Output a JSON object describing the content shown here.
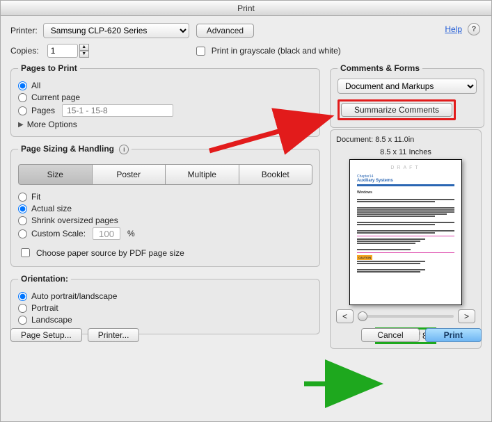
{
  "title": "Print",
  "help_label": "Help",
  "printer": {
    "label": "Printer:",
    "selected": "Samsung CLP-620 Series",
    "advanced": "Advanced"
  },
  "copies": {
    "label": "Copies:",
    "value": "1",
    "grayscale": "Print in grayscale (black and white)"
  },
  "pages": {
    "legend": "Pages to Print",
    "all": "All",
    "current": "Current page",
    "pages": "Pages",
    "range_placeholder": "15-1 - 15-8",
    "more_options": "More Options"
  },
  "sizing": {
    "legend": "Page Sizing & Handling",
    "tabs": {
      "size": "Size",
      "poster": "Poster",
      "multiple": "Multiple",
      "booklet": "Booklet"
    },
    "fit": "Fit",
    "actual": "Actual size",
    "shrink": "Shrink oversized pages",
    "custom": "Custom Scale:",
    "custom_value": "100",
    "percent": "%",
    "choose_source": "Choose paper source by PDF page size"
  },
  "orientation": {
    "legend": "Orientation:",
    "auto": "Auto portrait/landscape",
    "portrait": "Portrait",
    "landscape": "Landscape"
  },
  "comments_forms": {
    "legend": "Comments & Forms",
    "selected": "Document and Markups",
    "summarize": "Summarize Comments"
  },
  "preview": {
    "doc_size": "Document: 8.5 x 11.0in",
    "inches": "8.5 x 11 Inches",
    "draft": "DRAFT",
    "chapter": "Chapter14",
    "heading": "Auxiliary Systems",
    "sub": "Windows",
    "caution": "CAUTION",
    "prev": "<",
    "next": ">",
    "page": "Page 1 of 8"
  },
  "buttons": {
    "page_setup": "Page Setup...",
    "printer": "Printer...",
    "cancel": "Cancel",
    "print": "Print"
  }
}
